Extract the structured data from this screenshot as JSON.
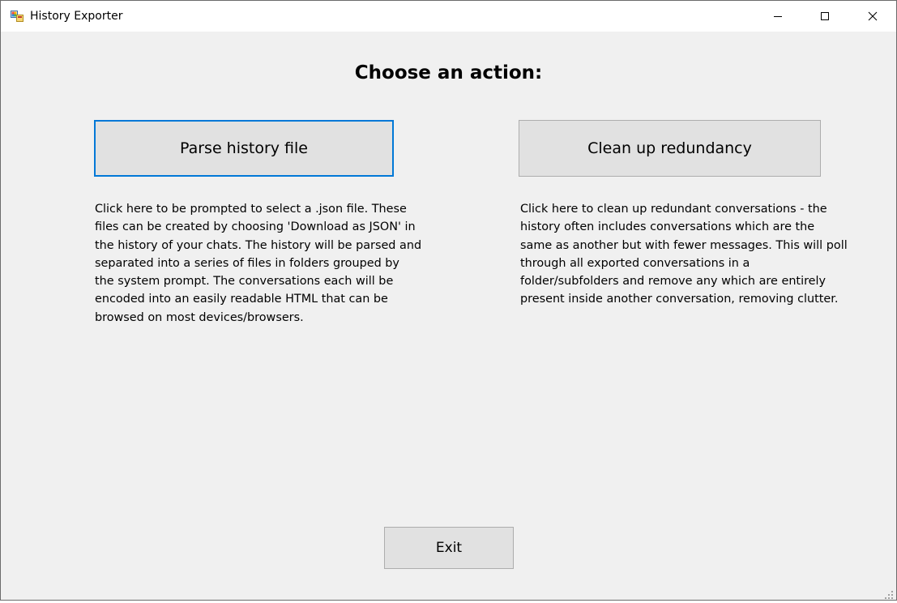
{
  "window": {
    "title": "History Exporter",
    "icon": "winforms-app-icon",
    "controls": [
      "minimize-icon",
      "maximize-icon",
      "close-icon"
    ]
  },
  "main": {
    "heading": "Choose an action:",
    "parse": {
      "button_label": "Parse history file",
      "description_lines": [
        "Click here to be prompted to select a .json file. These",
        "files can be created by choosing 'Download as JSON' in",
        "the history of your chats. The history will be parsed and",
        "separated into a series of files in folders grouped by",
        "the system prompt. The conversations each will be",
        "encoded into an easily readable HTML that can be",
        "browsed on most devices/browsers."
      ]
    },
    "cleanup": {
      "button_label": "Clean up redundancy",
      "description_lines": [
        "Click here to clean up redundant conversations - the",
        "history often includes conversations which are the",
        "same as another but with fewer messages. This will poll",
        "through all exported conversations in a",
        "folder/subfolders and remove any which are entirely",
        "present inside another conversation, removing clutter."
      ]
    },
    "exit_label": "Exit"
  },
  "colors": {
    "window_bg": "#f0f0f0",
    "button_bg": "#e1e1e1",
    "focus_border": "#0078d7"
  }
}
